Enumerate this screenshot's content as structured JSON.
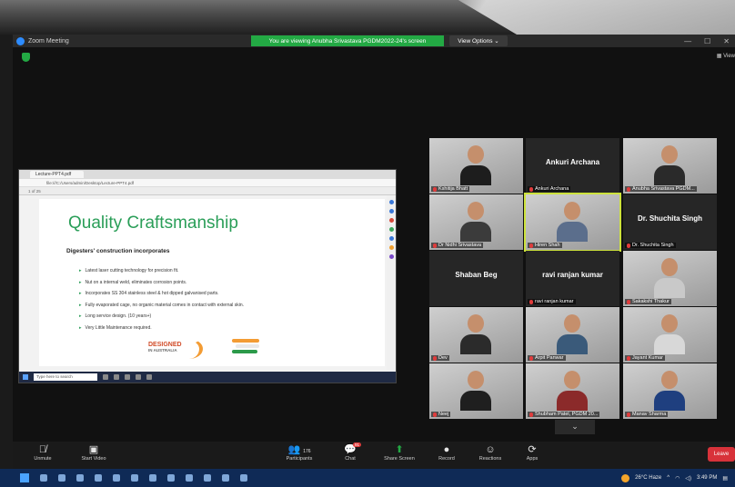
{
  "zoom": {
    "title": "Zoom Meeting",
    "banner": "You are viewing Anubha Srivastava PGDM2022-24's screen",
    "view_options": "View Options",
    "view_top": "View"
  },
  "shared_screen": {
    "browser_tab": "Lecture-PPT4.pdf",
    "url": "file:///C:/Users/admin/Desktop/Lecture-PPT4.pdf",
    "pdf_toolbar": "1 of 25",
    "slide": {
      "title": "Quality Craftsmanship",
      "subtitle": "Digesters' construction incorporates",
      "bullets": [
        "Latest laser cutting technology for precision fit.",
        "Nut on a internal weld, eliminates corrosion points.",
        "Incorporates SS 304 stainless steel & hot dipped galvanised parts.",
        "Fully evaporated cage, no organic material comes in contact with external skin.",
        "Long service design. (10 years+)",
        "Very Little Maintenance required."
      ],
      "logo_text": "DESIGNED",
      "logo_sub": "IN AUSTRALIA"
    },
    "search_placeholder": "Type here to search"
  },
  "participants": [
    {
      "name": "Kshitija Bhatt",
      "big": "",
      "kind": "video",
      "shirt": "#1d1d1d"
    },
    {
      "name": "Ankuri Archana",
      "big": "Ankuri Archana",
      "kind": "blank"
    },
    {
      "name": "Anubha Srivastava PGDM...",
      "big": "",
      "kind": "video",
      "shirt": "#2a2a2a"
    },
    {
      "name": "Dr Nidhi Srivastava",
      "big": "",
      "kind": "video",
      "shirt": "#3b3b3b"
    },
    {
      "name": "Hiren Shah",
      "big": "",
      "kind": "video",
      "shirt": "#5b6e8c",
      "active": true
    },
    {
      "name": "Dr. Shuchita Singh",
      "big": "Dr. Shuchita Singh",
      "kind": "blank"
    },
    {
      "name": "Shaban Beg",
      "big": "Shaban Beg",
      "kind": "blank",
      "label_hidden": true
    },
    {
      "name": "ravi ranjan kumar",
      "big": "ravi ranjan kumar",
      "kind": "blank"
    },
    {
      "name": "Sakakshi Thakur",
      "big": "",
      "kind": "video",
      "shirt": "#c9c9c9"
    },
    {
      "name": "Dev",
      "big": "",
      "kind": "video",
      "shirt": "#2b2b2b"
    },
    {
      "name": "Arpit Panwar",
      "big": "",
      "kind": "video",
      "shirt": "#3a5a7a"
    },
    {
      "name": "Jayant Kumar",
      "big": "",
      "kind": "video",
      "shirt": "#d8d8d8"
    },
    {
      "name": "Neej",
      "big": "",
      "kind": "video",
      "shirt": "#1f1f1f"
    },
    {
      "name": "Shubham Patel, PGDM 20...",
      "big": "",
      "kind": "video",
      "shirt": "#8b2a2a"
    },
    {
      "name": "Manav Sharma",
      "big": "",
      "kind": "video",
      "shirt": "#1f3f7f"
    }
  ],
  "controls": {
    "unmute": "Unmute",
    "start_video": "Start Video",
    "participants": "Participants",
    "participants_count": "176",
    "chat": "Chat",
    "chat_badge": "91",
    "share_screen": "Share Screen",
    "record": "Record",
    "reactions": "Reactions",
    "apps": "Apps",
    "leave": "Leave"
  },
  "taskbar": {
    "weather": "26°C Haze",
    "time": "3:49 PM"
  }
}
